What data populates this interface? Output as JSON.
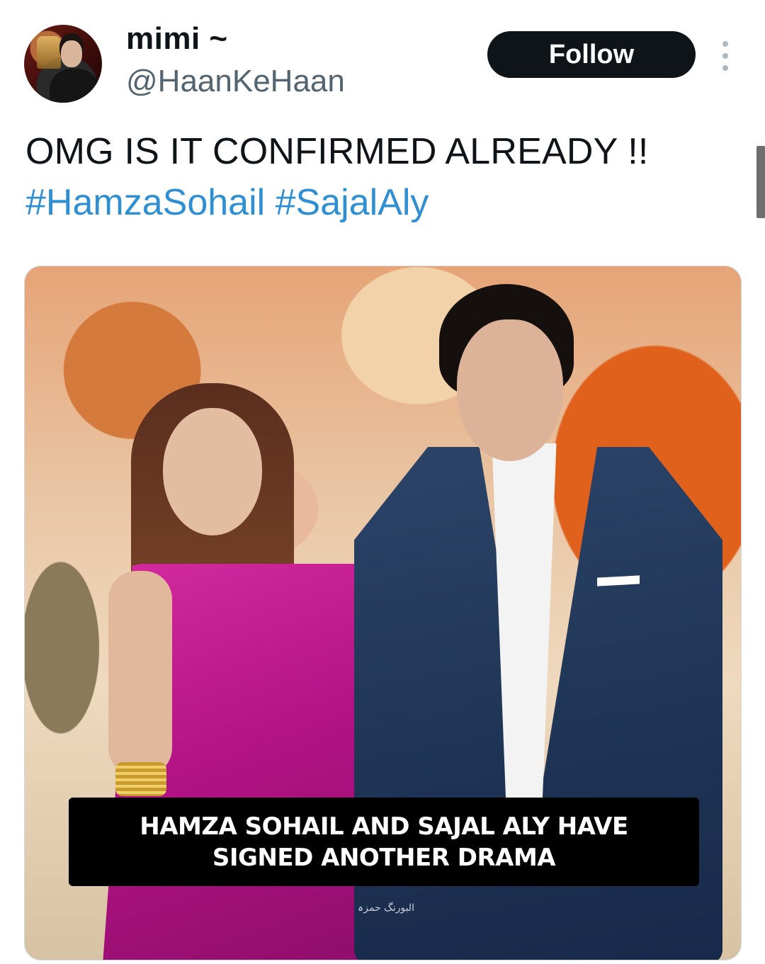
{
  "tweet": {
    "author": {
      "display_name": "mimi ~",
      "handle": "@HaanKeHaan",
      "avatar_icon": "profile-photo"
    },
    "follow_label": "Follow",
    "more_icon": "more-options-icon",
    "text": "OMG IS IT CONFIRMED ALREADY !!",
    "hashtags": [
      "#HamzaSohail",
      "#SajalAly"
    ],
    "media": {
      "caption_line1": "HAMZA SOHAIL AND SAJAL ALY HAVE",
      "caption_line2": "SIGNED ANOTHER DRAMA",
      "watermark": "البورنگ حمزہ"
    }
  },
  "colors": {
    "text": "#0f1419",
    "secondary_text": "#536471",
    "hashtag": "#2f8fd3",
    "follow_bg": "#0f1419",
    "follow_text": "#ffffff",
    "caption_bg": "#000000"
  }
}
